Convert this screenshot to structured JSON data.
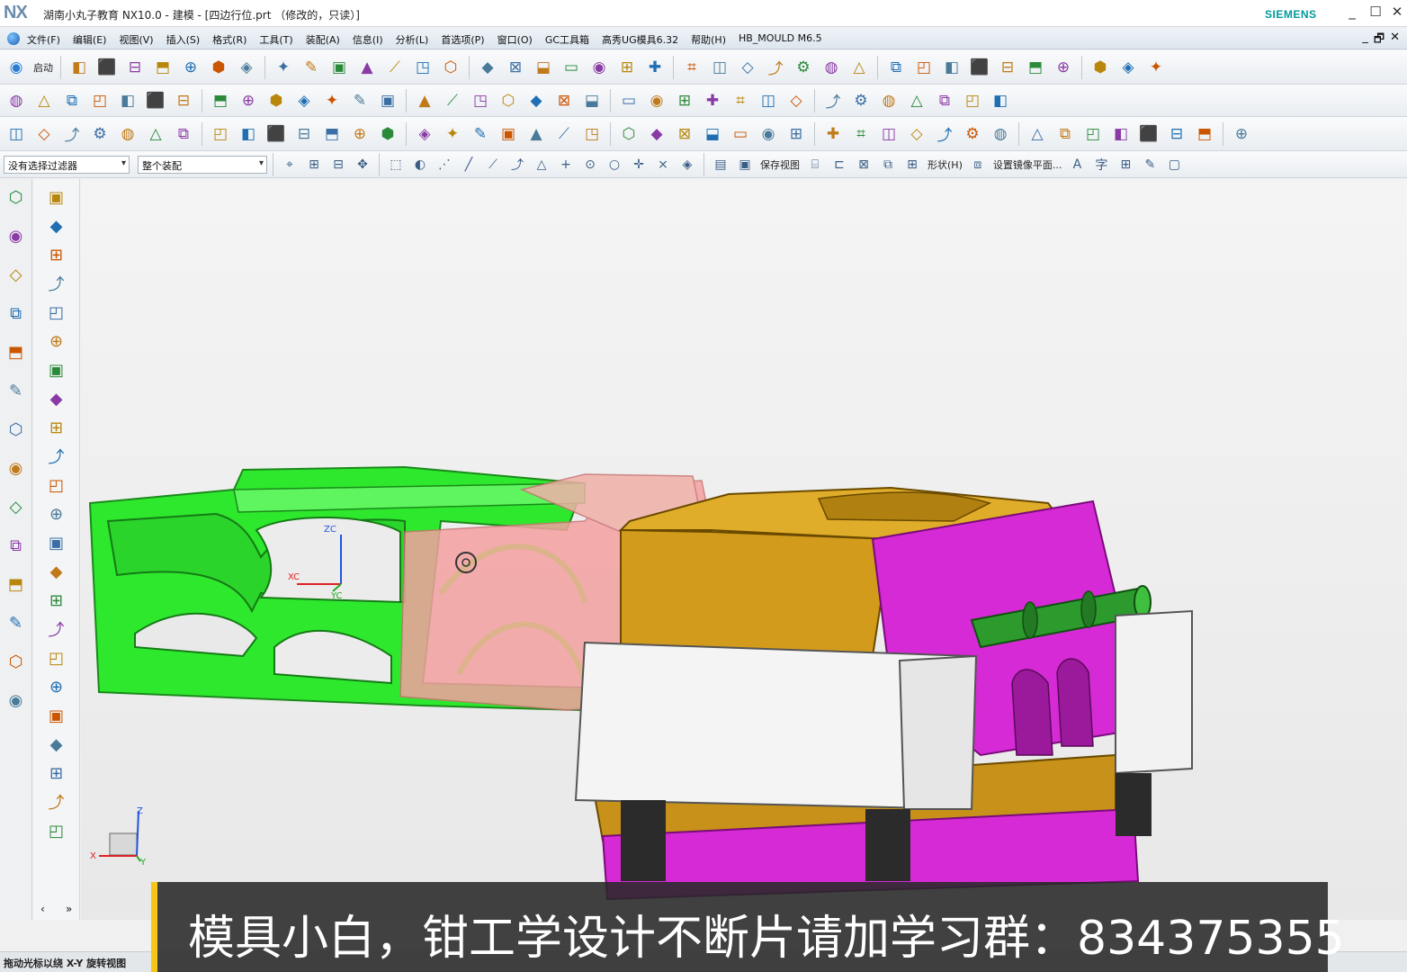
{
  "titlebar": {
    "logo": "NX",
    "title": "湖南小丸子教育 NX10.0 - 建模 - [四边行位.prt （修改的，只读）]",
    "brand": "SIEMENS",
    "minimize": "_",
    "maximize": "☐",
    "close": "✕"
  },
  "menubar": {
    "items": [
      "文件(F)",
      "编辑(E)",
      "视图(V)",
      "插入(S)",
      "格式(R)",
      "工具(T)",
      "装配(A)",
      "信息(I)",
      "分析(L)",
      "首选项(P)",
      "窗口(O)",
      "GC工具箱",
      "高秀UG模具6.32",
      "帮助(H)",
      "HB_MOULD M6.5"
    ],
    "right": [
      "_",
      "🗗",
      "✕"
    ]
  },
  "toolbar1": {
    "start_label": "启动",
    "icons": [
      "new-file",
      "open-folder",
      "save",
      "cut",
      "undo",
      "redo",
      "repeat",
      "measure",
      "snap",
      "fit-view",
      "zoom",
      "pan",
      "rotate",
      "orient",
      "render-style",
      "shaded-box",
      "wire-box",
      "wire-box2",
      "iso-box",
      "layer",
      "selection-priority",
      "line",
      "polyline",
      "parallel",
      "perpendicular",
      "arc",
      "spline",
      "curve",
      "offset-curve",
      "grid",
      "fillet",
      "chamfer",
      "rectangle",
      "corner",
      "circle",
      "circle2",
      "circle3",
      "ellipse"
    ]
  },
  "toolbar2": {
    "icons": [
      "sketch",
      "block",
      "cylinder-feature",
      "cone-feature",
      "box",
      "hole",
      "slot",
      "groove",
      "sphere",
      "cylinder",
      "cube",
      "cone",
      "tube",
      "edge-blend",
      "pattern",
      "shell",
      "offset",
      "draft",
      "thicken",
      "mirror",
      "extract",
      "split",
      "trim",
      "unite",
      "subtract",
      "intersect",
      "replace",
      "sew",
      "patch",
      "datum",
      "point",
      "plane",
      "projection",
      "intersection",
      "curve-tool"
    ]
  },
  "toolbar3": {
    "icons": [
      "layers",
      "paint",
      "tools",
      "select",
      "snap-point",
      "filter",
      "surface",
      "through-curves",
      "mesh",
      "swept",
      "ruled",
      "extend",
      "n-sided",
      "trim-sheet",
      "bridge",
      "face-blend",
      "law",
      "sweep",
      "tube2",
      "cylinder3",
      "box3",
      "mold-tool",
      "insert",
      "parting",
      "core",
      "cavity",
      "slider",
      "lifter",
      "ejector",
      "cooling",
      "line2",
      "arc2",
      "rect2",
      "node",
      "polygon",
      "text-A",
      "shape",
      "curve2",
      "fitting",
      "dimension",
      "chamfer2",
      "offset2",
      "view2"
    ]
  },
  "toolbar4": {
    "filter_label": "没有选择过滤器",
    "scope_label": "整个装配",
    "save_view_label": "保存视图",
    "shape_label": "形状(H)",
    "mirror_plane_label": "设置镜像平面...",
    "text_icon": "A",
    "char_icon": "字"
  },
  "rail1": {
    "icons": [
      "gear",
      "assembly-navigator",
      "constraint",
      "part-navigator",
      "reuse-library",
      "info",
      "document",
      "history",
      "palette",
      "measure2",
      "robot",
      "roles",
      "process",
      "layers2"
    ]
  },
  "rail2": {
    "icons": [
      "doc-list",
      "mold-wizard",
      "layout",
      "csys",
      "block-tool",
      "slice",
      "panels",
      "tools2",
      "stack",
      "grid2",
      "cylinder-tool",
      "lifter-tool",
      "slide-tool",
      "mountain",
      "screen",
      "split2",
      "menu-tool",
      "weld",
      "insert2",
      "frame",
      "window",
      "eye",
      "refresh"
    ],
    "bottom_left": "‹",
    "bottom_right": "»"
  },
  "viewport": {
    "wcs_labels": [
      "ZC",
      "XC",
      "YC"
    ],
    "triad_labels": [
      "Z",
      "X",
      "Y"
    ]
  },
  "colors": {
    "green_part": "#2ee82e",
    "pink_part": "#f4a0a0",
    "gold_part": "#d7a11f",
    "magenta_part": "#d52ad5",
    "white_part": "#f2f2f2",
    "dark_pin": "#2b2b2b",
    "green_pin": "#2d9a2d",
    "subtitle_accent": "#f5c518"
  },
  "statusbar": {
    "text": "拖动光标以绕 X-Y 旋转视图"
  },
  "subtitle": {
    "text": "模具小白，钳工学设计不断片请加学习群：834375355"
  }
}
